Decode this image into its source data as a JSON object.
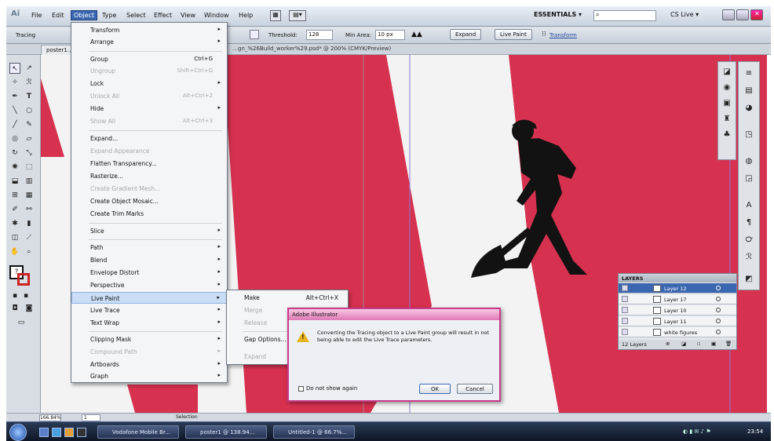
{
  "menubar": {
    "logo": "Ai",
    "items": [
      "File",
      "Edit",
      "Object",
      "Type",
      "Select",
      "Effect",
      "View",
      "Window",
      "Help"
    ],
    "workspace": "ESSENTIALS ▾",
    "search_placeholder": "",
    "cs_live": "CS Live ▾"
  },
  "control_bar": {
    "mode": "Tracing",
    "threshold_label": "Threshold:",
    "threshold_value": "128",
    "min_area_label": "Min Area:",
    "min_area_value": "10 px",
    "expand": "Expand",
    "live_paint": "Live Paint",
    "transform": "Transform"
  },
  "document": {
    "tab": "poster1…",
    "title": "…gn_%26Build_worker%29.psd* @ 200% (CMYK/Preview)"
  },
  "object_menu": {
    "items": [
      {
        "label": "Transform",
        "shortcut": "",
        "arrow": true,
        "disabled": false
      },
      {
        "label": "Arrange",
        "shortcut": "",
        "arrow": true,
        "disabled": false
      },
      {
        "label": "Group",
        "shortcut": "Ctrl+G",
        "arrow": false,
        "disabled": false
      },
      {
        "label": "Ungroup",
        "shortcut": "Shift+Ctrl+G",
        "arrow": false,
        "disabled": true
      },
      {
        "label": "Lock",
        "shortcut": "",
        "arrow": true,
        "disabled": false
      },
      {
        "label": "Unlock All",
        "shortcut": "Alt+Ctrl+2",
        "arrow": false,
        "disabled": true
      },
      {
        "label": "Hide",
        "shortcut": "",
        "arrow": true,
        "disabled": false
      },
      {
        "label": "Show All",
        "shortcut": "Alt+Ctrl+3",
        "arrow": false,
        "disabled": true
      },
      {
        "label": "Expand...",
        "shortcut": "",
        "arrow": false,
        "disabled": false
      },
      {
        "label": "Expand Appearance",
        "shortcut": "",
        "arrow": false,
        "disabled": true
      },
      {
        "label": "Flatten Transparency...",
        "shortcut": "",
        "arrow": false,
        "disabled": false
      },
      {
        "label": "Rasterize...",
        "shortcut": "",
        "arrow": false,
        "disabled": false
      },
      {
        "label": "Create Gradient Mesh...",
        "shortcut": "",
        "arrow": false,
        "disabled": true
      },
      {
        "label": "Create Object Mosaic...",
        "shortcut": "",
        "arrow": false,
        "disabled": false
      },
      {
        "label": "Create Trim Marks",
        "shortcut": "",
        "arrow": false,
        "disabled": false
      },
      {
        "label": "Slice",
        "shortcut": "",
        "arrow": true,
        "disabled": false
      },
      {
        "label": "Path",
        "shortcut": "",
        "arrow": true,
        "disabled": false
      },
      {
        "label": "Blend",
        "shortcut": "",
        "arrow": true,
        "disabled": false
      },
      {
        "label": "Envelope Distort",
        "shortcut": "",
        "arrow": true,
        "disabled": false
      },
      {
        "label": "Perspective",
        "shortcut": "",
        "arrow": true,
        "disabled": false
      },
      {
        "label": "Live Paint",
        "shortcut": "",
        "arrow": true,
        "disabled": false
      },
      {
        "label": "Live Trace",
        "shortcut": "",
        "arrow": true,
        "disabled": false
      },
      {
        "label": "Text Wrap",
        "shortcut": "",
        "arrow": true,
        "disabled": false
      },
      {
        "label": "Clipping Mask",
        "shortcut": "",
        "arrow": true,
        "disabled": false
      },
      {
        "label": "Compound Path",
        "shortcut": "",
        "arrow": true,
        "disabled": true
      },
      {
        "label": "Artboards",
        "shortcut": "",
        "arrow": true,
        "disabled": false
      },
      {
        "label": "Graph",
        "shortcut": "",
        "arrow": true,
        "disabled": false
      }
    ]
  },
  "live_paint_submenu": {
    "items": [
      {
        "label": "Make",
        "shortcut": "Alt+Ctrl+X",
        "disabled": false
      },
      {
        "label": "Merge",
        "shortcut": "",
        "disabled": true
      },
      {
        "label": "Release",
        "shortcut": "",
        "disabled": true
      },
      {
        "label": "Gap Options...",
        "shortcut": "",
        "disabled": false
      },
      {
        "label": "Expand",
        "shortcut": "",
        "disabled": true
      }
    ]
  },
  "dialog": {
    "title": "Adobe Illustrator",
    "message": "Converting the Tracing object to a Live Paint group will result in not being able to edit the Live Trace parameters.",
    "checkbox": "Do not show again",
    "ok": "OK",
    "cancel": "Cancel"
  },
  "layers_panel": {
    "title": "LAYERS",
    "rows": [
      {
        "name": "Layer 12",
        "selected": true
      },
      {
        "name": "Layer 17",
        "selected": false
      },
      {
        "name": "Layer 10",
        "selected": false
      },
      {
        "name": "Layer 11",
        "selected": false
      },
      {
        "name": "white figures",
        "selected": false
      }
    ],
    "footer": "12 Layers"
  },
  "status_bar": {
    "zoom": "166.84%",
    "page": "1",
    "tool": "Selection"
  },
  "taskbar": {
    "items": [
      "Vodafone Mobile Br...",
      "poster1 @ 138.94...",
      "Untitled-1 @ 66.7%..."
    ],
    "clock": "23:54"
  },
  "colors": {
    "canvas_red": "#d6314f",
    "menu_highlight": "#c9ddf6",
    "dialog_border": "#c83a8a"
  }
}
